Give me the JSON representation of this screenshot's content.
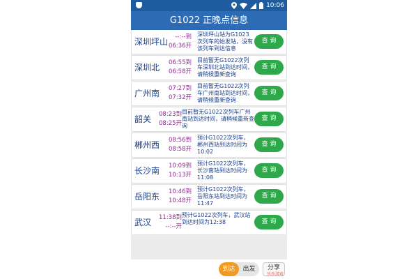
{
  "status_bar": {
    "time": "10:06"
  },
  "header": {
    "title": "G1022 正晚点信息"
  },
  "stations": [
    {
      "name": "深圳坪山",
      "arrive": "--:--到",
      "depart": "06:36开",
      "info": "深圳坪山站为G1023次列车的始发站，没有该列车到达信息",
      "button": "查 询"
    },
    {
      "name": "深圳北",
      "arrive": "06:55到",
      "depart": "06:58开",
      "info": "目前暂无G1022次列车深圳北站到达时间，请稍候重新查询",
      "button": "查 询"
    },
    {
      "name": "广州南",
      "arrive": "07:27到",
      "depart": "07:32开",
      "info": "目前暂无G1022次列车广州南站到达时间，请稍候重新查询",
      "button": "查 询"
    },
    {
      "name": "韶关",
      "arrive": "08:23到",
      "depart": "08:25开",
      "info": "目前暂无G1022次列车广州南站到达时间，请稍候重新查询",
      "button": "查 询"
    },
    {
      "name": "郴州西",
      "arrive": "08:56到",
      "depart": "08:58开",
      "info": "预计G1022次列车，郴州西站到达时间为10:02",
      "button": "查 询"
    },
    {
      "name": "长沙南",
      "arrive": "10:09到",
      "depart": "10:13开",
      "info": "预计G1022次列车，长沙南站到达时间为11:08",
      "button": "查 询"
    },
    {
      "name": "岳阳东",
      "arrive": "10:46到",
      "depart": "10:48开",
      "info": "预计G1022次列车，岳阳东站到达时间为11:47",
      "button": "查 询"
    },
    {
      "name": "武汉",
      "arrive": "11:38到",
      "depart": "--:--开",
      "info": "预计G1022次列车，武汉站到达时间为12:38",
      "button": "查 询"
    }
  ],
  "bottom_bar": {
    "toggle_arrive": "到达",
    "toggle_depart": "出发",
    "share": "分享",
    "watermark": "乐乐游戏"
  },
  "colors": {
    "header_bg": "#2d6bb5",
    "status_bg": "#1e5c9e",
    "station_text": "#1a3f8a",
    "time_text": "#8e2a8e",
    "button_green": "#2ea84a",
    "toggle_active": "#f39a1e"
  },
  "icons": [
    "shield-icon",
    "location-icon",
    "wifi-icon",
    "signal-icon",
    "battery-icon"
  ]
}
